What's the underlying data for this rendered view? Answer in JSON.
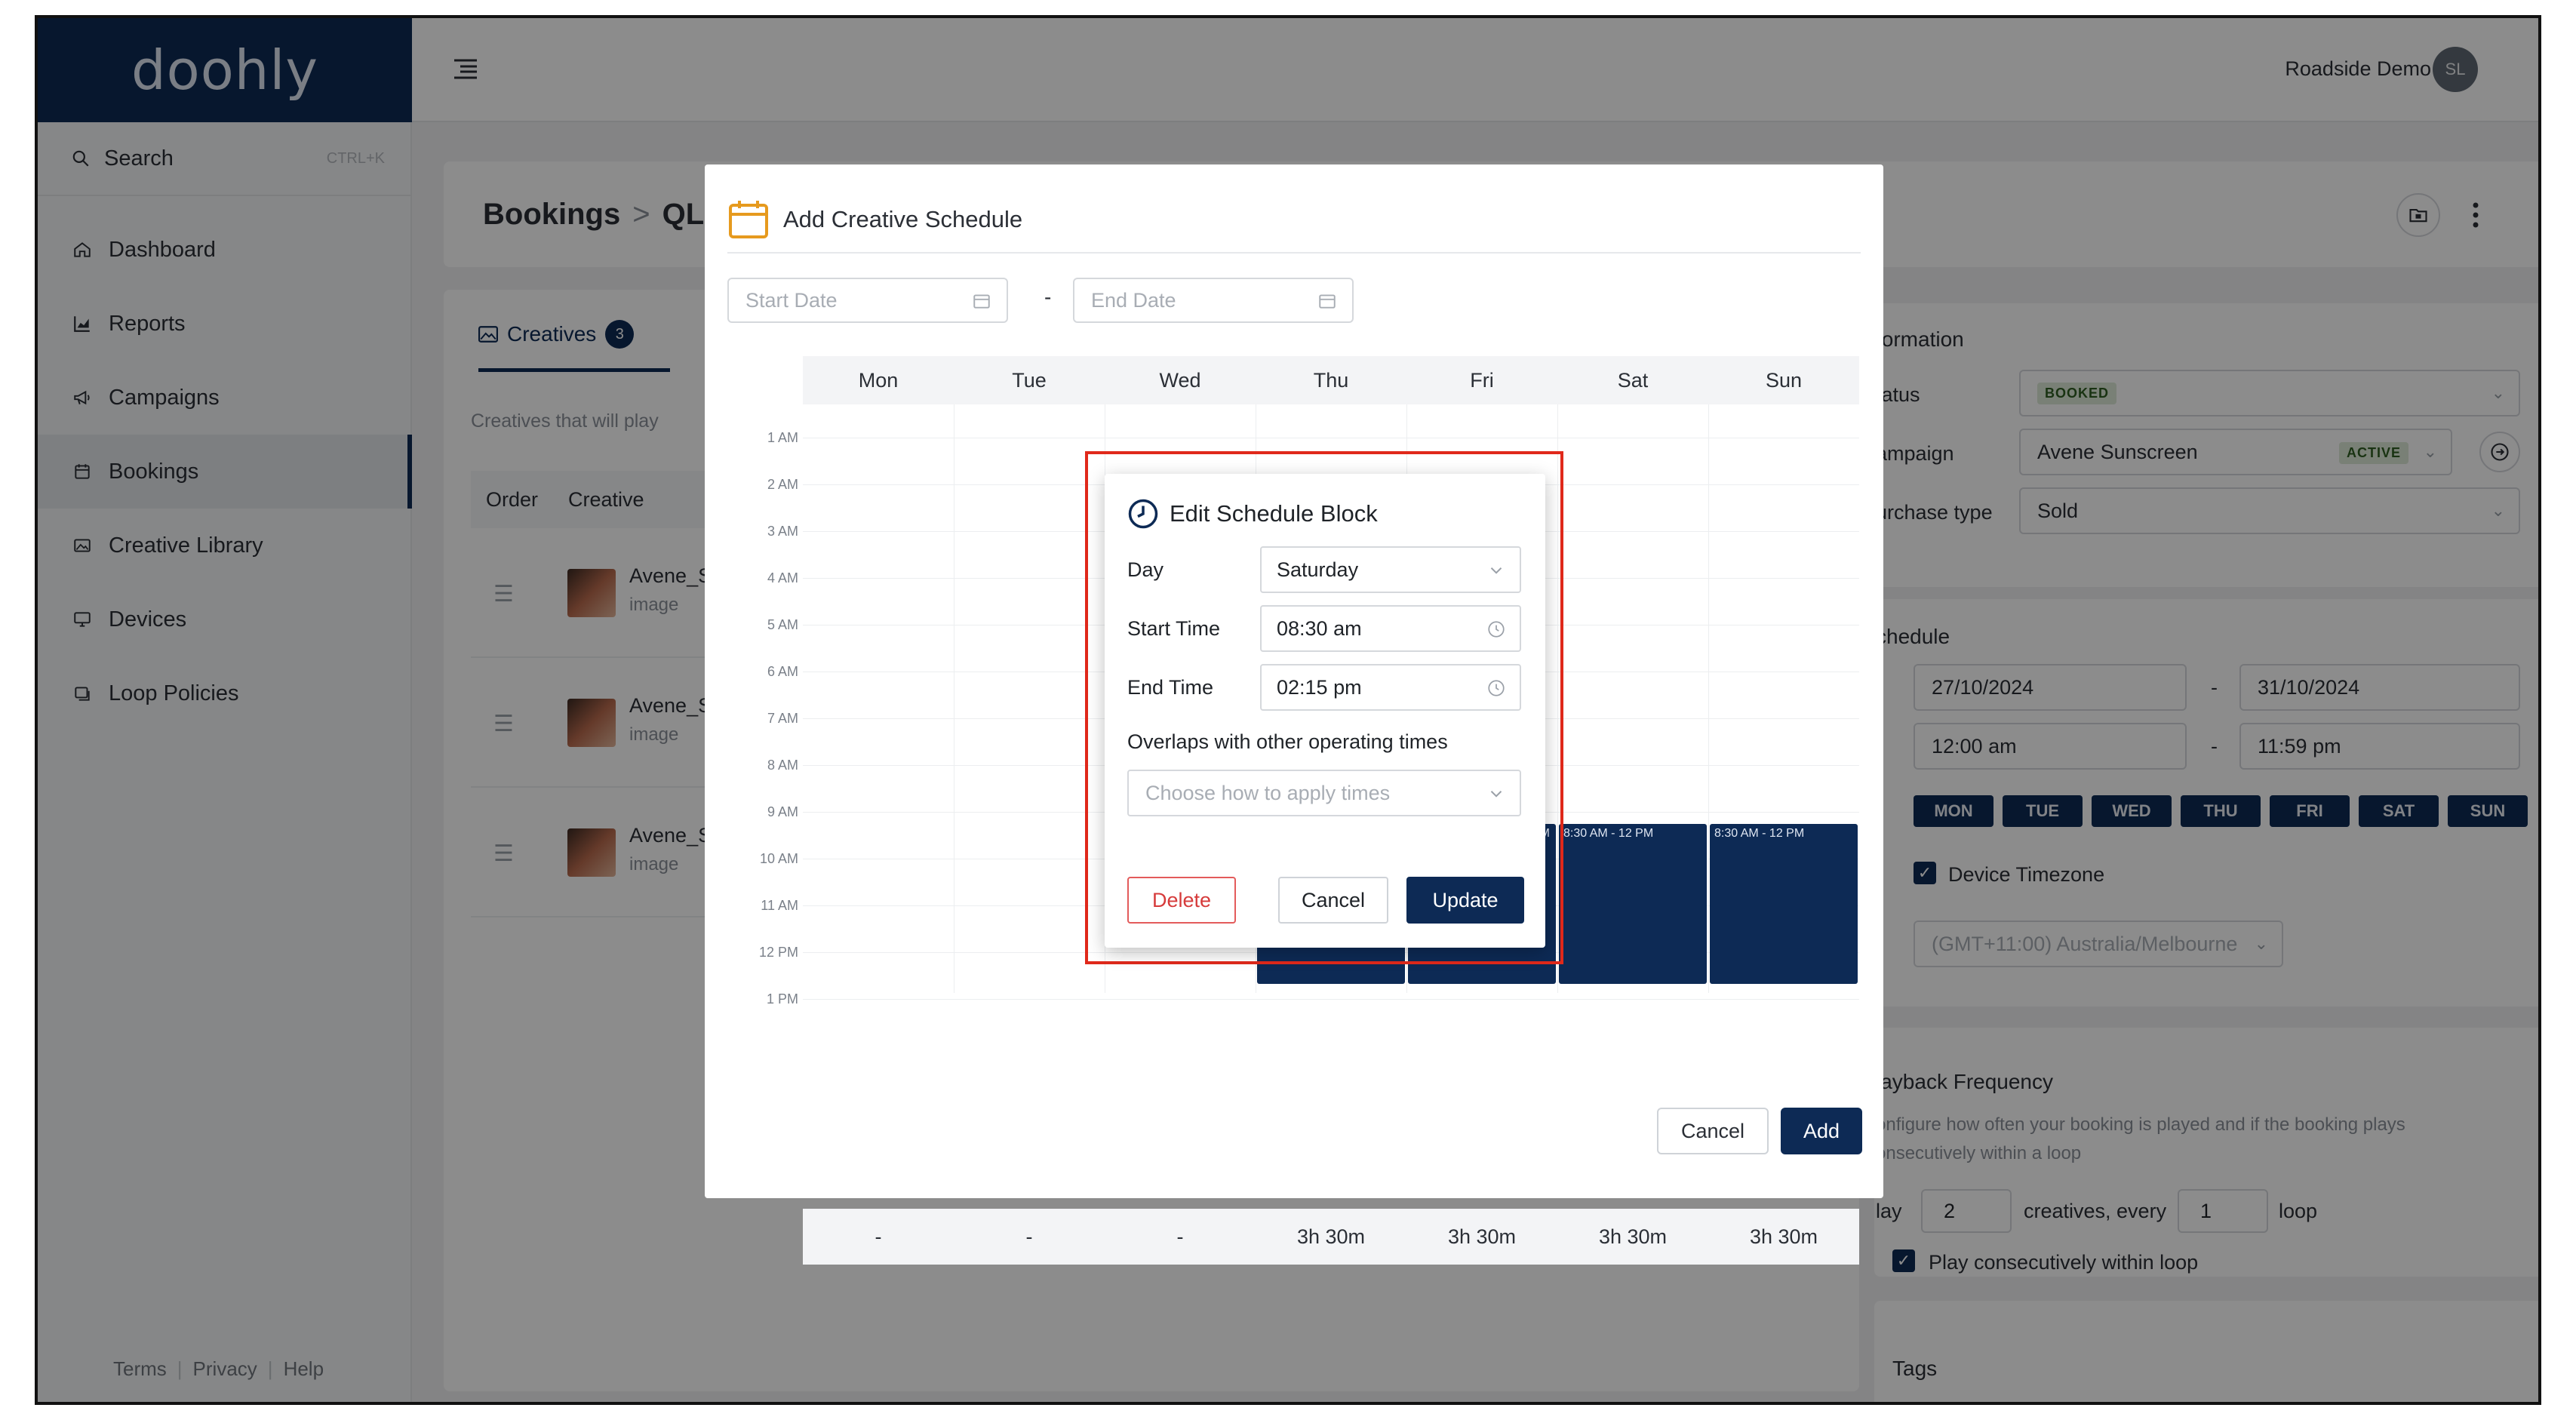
{
  "app": {
    "logo": "doohly",
    "user_name": "Roadside Demo",
    "avatar_initials": "SL"
  },
  "sidebar": {
    "search_label": "Search",
    "search_shortcut": "CTRL+K",
    "items": [
      {
        "label": "Dashboard",
        "icon": "home-icon"
      },
      {
        "label": "Reports",
        "icon": "chart-icon"
      },
      {
        "label": "Campaigns",
        "icon": "megaphone-icon"
      },
      {
        "label": "Bookings",
        "icon": "calendar-icon",
        "active": true
      },
      {
        "label": "Creative Library",
        "icon": "image-icon"
      },
      {
        "label": "Devices",
        "icon": "monitor-icon"
      },
      {
        "label": "Loop Policies",
        "icon": "loop-icon"
      }
    ],
    "footer": [
      "Terms",
      "Privacy",
      "Help"
    ]
  },
  "page": {
    "breadcrumb_root": "Bookings",
    "breadcrumb_current": "QLD",
    "tab_creatives": "Creatives",
    "tab_creatives_count": "3",
    "creatives_note": "Creatives that will play",
    "table_headers": [
      "Order",
      "Creative"
    ],
    "creatives": [
      {
        "name": "Avene_S",
        "type": "image"
      },
      {
        "name": "Avene_S",
        "type": "image"
      },
      {
        "name": "Avene_S",
        "type": "image"
      }
    ]
  },
  "info": {
    "title": "formation",
    "status_label": "tatus",
    "status_value": "BOOKED",
    "campaign_label": "ampaign",
    "campaign_value": "Avene Sunscreen",
    "campaign_badge": "ACTIVE",
    "purchase_label": "urchase type",
    "purchase_value": "Sold"
  },
  "schedule": {
    "title": "chedule",
    "start_date": "27/10/2024",
    "end_date": "31/10/2024",
    "start_time": "12:00 am",
    "end_time": "11:59 pm",
    "days": [
      "MON",
      "TUE",
      "WED",
      "THU",
      "FRI",
      "SAT",
      "SUN"
    ],
    "device_timezone_label": "Device Timezone",
    "timezone_value": "(GMT+11:00) Australia/Melbourne"
  },
  "playback": {
    "title": "layback Frequency",
    "description": "onfigure how often your booking is played and if the booking plays onsecutively within a loop",
    "play_label": "lay",
    "play_count": "2",
    "creatives_every": "creatives, every",
    "loop_count": "1",
    "loop_label": "loop",
    "consecutive_label": "Play consecutively within loop"
  },
  "tags": {
    "title": "Tags"
  },
  "modal": {
    "title": "Add Creative Schedule",
    "start_date_placeholder": "Start Date",
    "end_date_placeholder": "End Date",
    "date_separator": "-",
    "days": [
      "Mon",
      "Tue",
      "Wed",
      "Thu",
      "Fri",
      "Sat",
      "Sun"
    ],
    "hours": [
      "1 AM",
      "2 AM",
      "3 AM",
      "4 AM",
      "5 AM",
      "6 AM",
      "7 AM",
      "8 AM",
      "9 AM",
      "10 AM",
      "11 AM",
      "12 PM",
      "1 PM"
    ],
    "block_label": "8:30 AM - 12 PM",
    "block_label_fri": "M",
    "totals": [
      "-",
      "-",
      "-",
      "3h 30m",
      "3h 30m",
      "3h 30m",
      "3h 30m"
    ],
    "cancel": "Cancel",
    "add": "Add"
  },
  "dialog": {
    "title": "Edit Schedule Block",
    "day_label": "Day",
    "day_value": "Saturday",
    "start_label": "Start Time",
    "start_value": "08:30 am",
    "end_label": "End Time",
    "end_value": "02:15 pm",
    "overlap_label": "Overlaps with other operating times",
    "overlap_placeholder": "Choose how to apply times",
    "delete": "Delete",
    "cancel": "Cancel",
    "update": "Update"
  },
  "colors": {
    "brand_navy": "#0d2a55",
    "highlight_red": "#e0291b",
    "delete_red": "#d63b3b"
  }
}
